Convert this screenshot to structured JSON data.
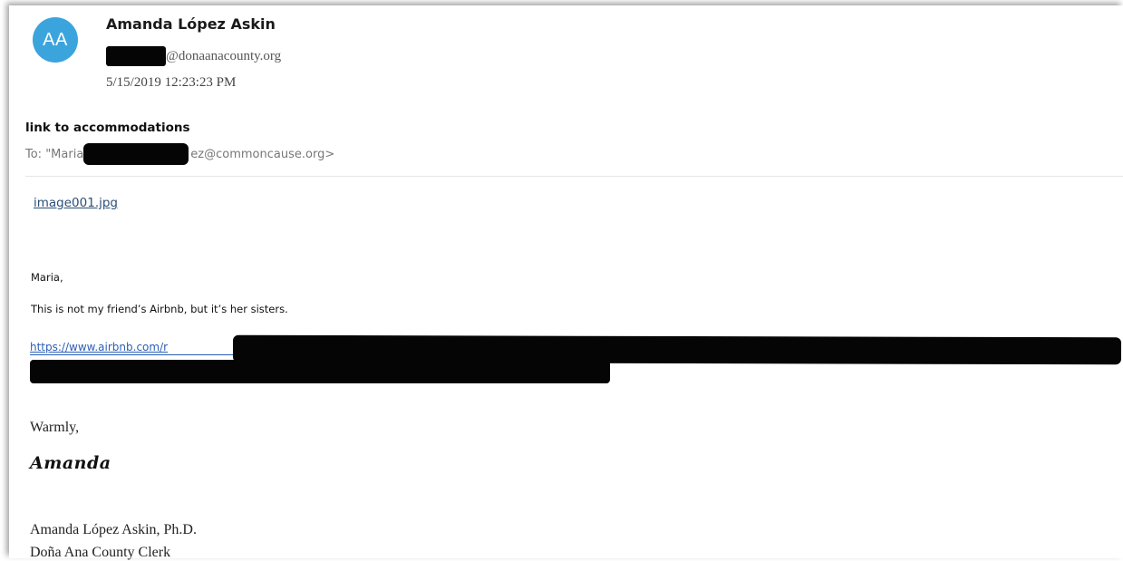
{
  "email": {
    "sender": {
      "initials": "AA",
      "name": "Amanda López Askin",
      "email_domain": "@donaanacounty.org",
      "avatar_color": "#3ba4dc"
    },
    "sent": "5/15/2019 12:23:23 PM",
    "subject": "link to accommodations",
    "to": {
      "prefix": "To: \"Maria",
      "suffix": "ez@commoncause.org>"
    },
    "attachment": "image001.jpg",
    "body": {
      "greeting": "Maria,",
      "line1": "This is not my friend’s Airbnb, but it’s her sisters.",
      "link_visible": "https://www.airbnb.com/r",
      "closing": "Warmly,",
      "signature": "Amanda",
      "sig_name": "Amanda López Askin, Ph.D.",
      "sig_title": "Doña Ana County Clerk"
    }
  },
  "colors": {
    "link": "#2b5fb3",
    "attachment_link": "#2a4f78",
    "redaction": "#050505"
  }
}
